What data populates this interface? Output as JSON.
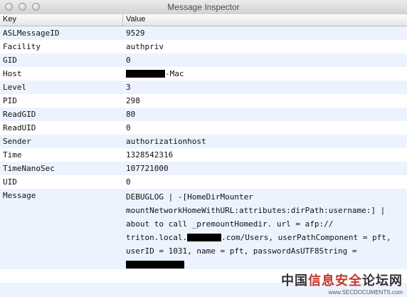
{
  "window": {
    "title": "Message Inspector"
  },
  "columns": {
    "key": "Key",
    "value": "Value"
  },
  "rows": [
    {
      "key": "ASLMessageID",
      "value": "9529"
    },
    {
      "key": "Facility",
      "value": "authpriv"
    },
    {
      "key": "GID",
      "value": "0"
    },
    {
      "key": "Host",
      "value": "-Mac",
      "redacted_prefix": true
    },
    {
      "key": "Level",
      "value": "3"
    },
    {
      "key": "PID",
      "value": "298"
    },
    {
      "key": "ReadGID",
      "value": "80"
    },
    {
      "key": "ReadUID",
      "value": "0"
    },
    {
      "key": "Sender",
      "value": "authorizationhost"
    },
    {
      "key": "Time",
      "value": "1328542316"
    },
    {
      "key": "TimeNanoSec",
      "value": "107721000"
    },
    {
      "key": "UID",
      "value": "0"
    }
  ],
  "message": {
    "key": "Message",
    "line1": "DEBUGLOG | -[HomeDirMounter",
    "line2": "mountNetworkHomeWithURL:attributes:dirPath:username:] |",
    "line3": "about to call _premountHomedir. url = afp://",
    "line4a": "triton.local.",
    "line4b": ".com/Users, userPathComponent = pft,",
    "line5": "userID = 1031, name = pft, passwordAsUTF8String ="
  },
  "watermark": {
    "text_a": "中国",
    "text_b": "信息安全",
    "text_c": "论坛网",
    "url": "www.SECDOCUMENTS.com"
  },
  "colors": {
    "row_alt": "#edf3fe",
    "redaction": "#000000"
  }
}
